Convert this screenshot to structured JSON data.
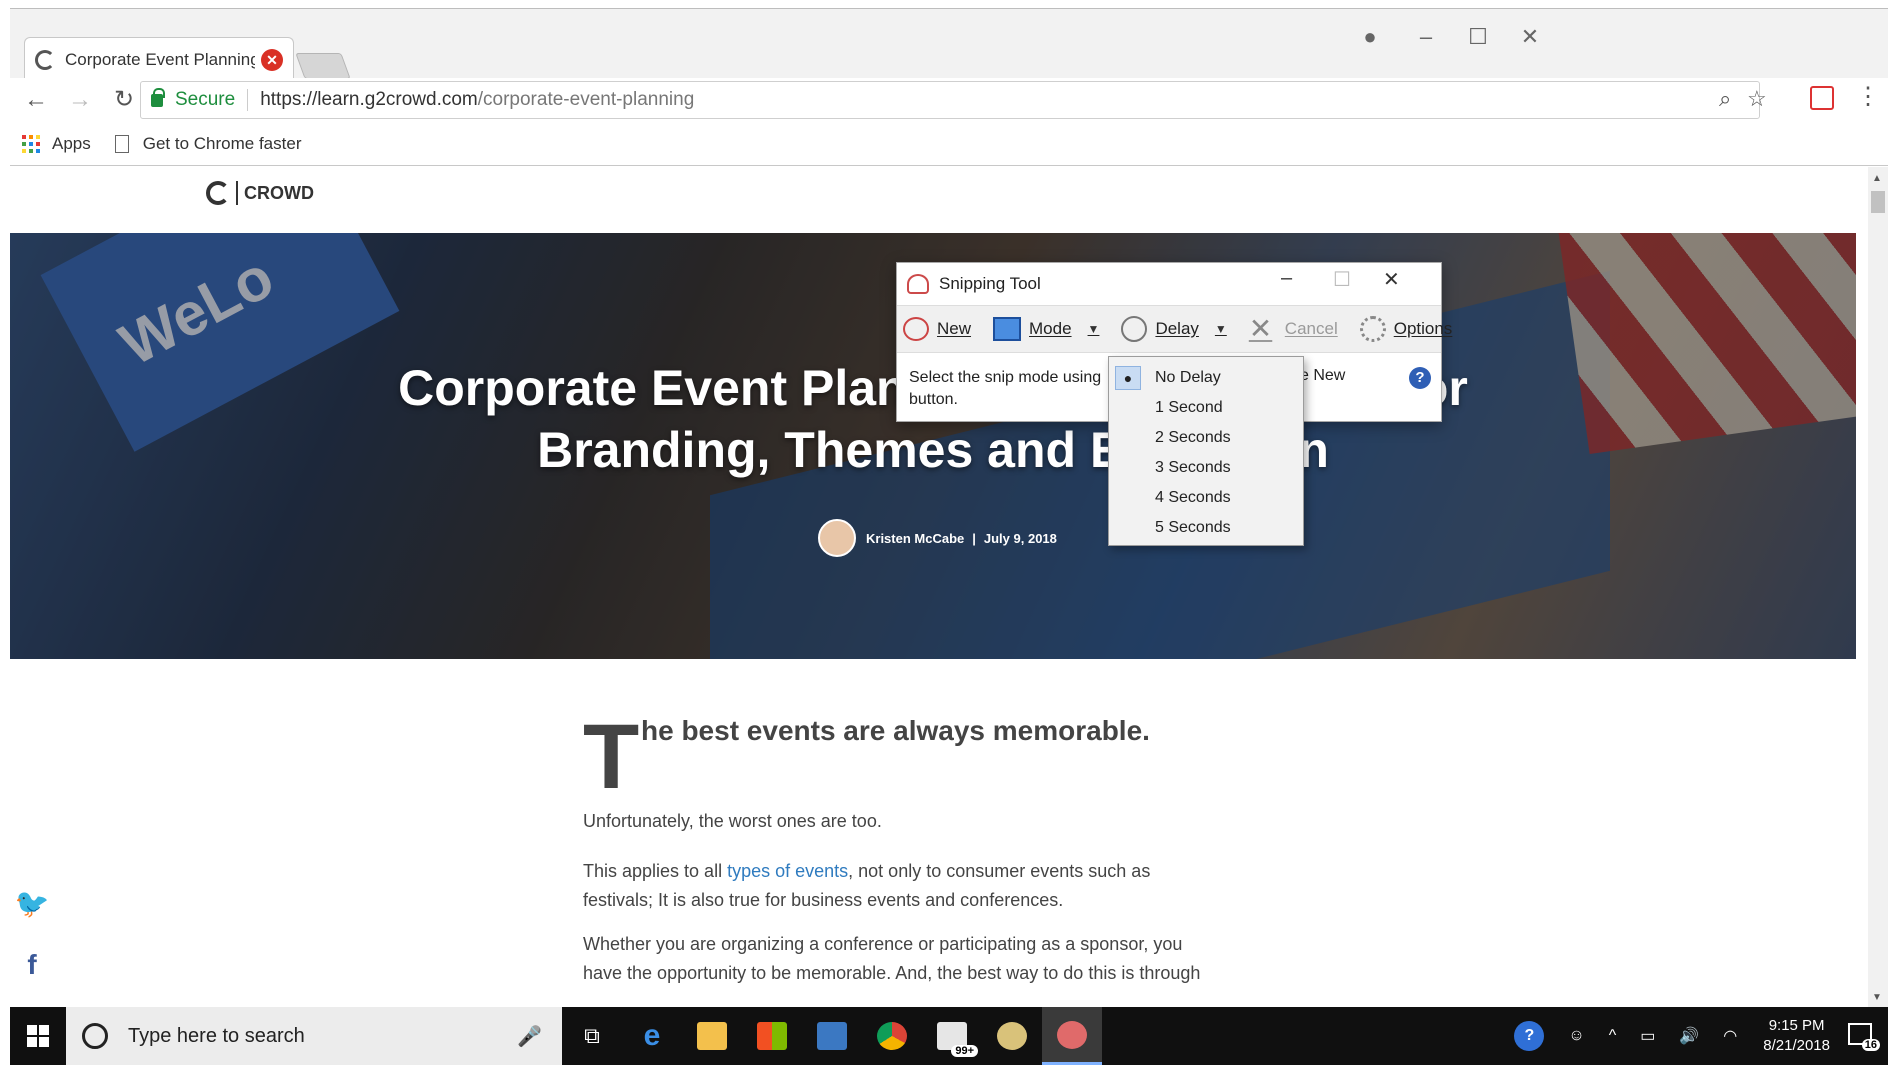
{
  "browser": {
    "tab": {
      "title": "Corporate Event Planning"
    },
    "address": {
      "secure_label": "Secure",
      "url_host": "https://learn.g2crowd.com",
      "url_path": "/corporate-event-planning"
    },
    "bookmarks": [
      {
        "label": "Apps"
      },
      {
        "label": "Get to Chrome faster"
      }
    ]
  },
  "page": {
    "logo": "CROWD",
    "hero": {
      "title_line1": "Corporate Event Planning: Best Practices for",
      "title_line2": "Branding, Themes and Execution",
      "author": "Kristen McCabe",
      "date": "July 9, 2018",
      "banner_text": "WeLo"
    },
    "article": {
      "dropcap": "T",
      "lead": "he best events are always memorable.",
      "p1": "Unfortunately, the worst ones are too.",
      "p2_before": "This applies to all ",
      "p2_link": "types of events",
      "p2_after": ", not only to consumer events such as festivals; It is also true for business events and conferences.",
      "p3": "Whether you are organizing a conference or participating as a sponsor, you have the opportunity to be memorable. And, the best way to do this is through"
    }
  },
  "snipping_tool": {
    "title": "Snipping Tool",
    "toolbar": {
      "new": "New",
      "mode": "Mode",
      "delay": "Delay",
      "cancel": "Cancel",
      "options": "Options"
    },
    "hint_left": "Select the snip mode using button.",
    "hint_right": "e New",
    "delay_menu": [
      "No Delay",
      "1 Second",
      "2 Seconds",
      "3 Seconds",
      "4 Seconds",
      "5 Seconds"
    ],
    "delay_selected": "No Delay"
  },
  "taskbar": {
    "search_placeholder": "Type here to search",
    "mail_badge": "99+",
    "time": "9:15 PM",
    "date": "8/21/2018",
    "notifications": "16"
  },
  "colors": {
    "link": "#2f7bbf",
    "secure": "#1e8e3e",
    "taskbar": "#101010"
  }
}
